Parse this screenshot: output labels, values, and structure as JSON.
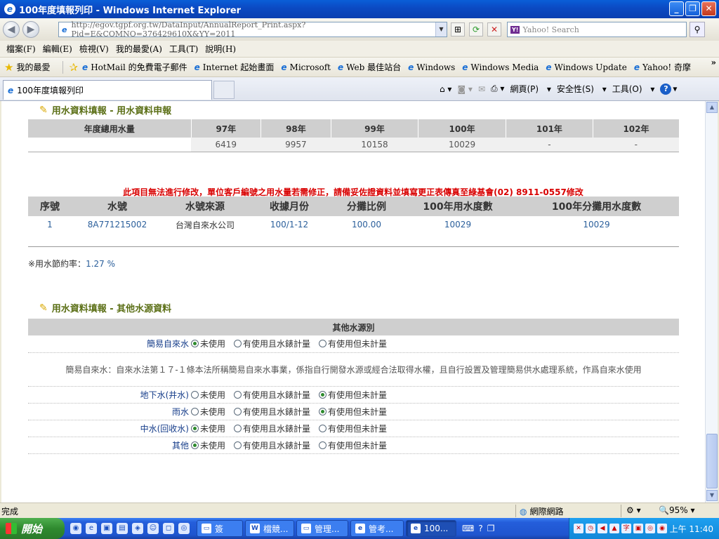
{
  "window": {
    "title": "100年度填報列印 - Windows Internet Explorer"
  },
  "addressbar": {
    "url": "http://egov.tgpf.org.tw/DataInput/AnnualReport_Print.aspx?Pid=E&COMNO=376429610X&YY=2011",
    "search_placeholder": "Yahoo! Search"
  },
  "menu": [
    "檔案(F)",
    "編輯(E)",
    "檢視(V)",
    "我的最愛(A)",
    "工具(T)",
    "說明(H)"
  ],
  "favorites": {
    "label": "我的最愛",
    "items": [
      "HotMail 的免費電子郵件",
      "Internet 起始畫面",
      "Microsoft",
      "Web 最佳站台",
      "Windows",
      "Windows Media",
      "Windows Update",
      "Yahoo! 奇摩"
    ]
  },
  "tab": {
    "label": "100年度填報列印"
  },
  "commands": {
    "page": "網頁(P)",
    "safety": "安全性(S)",
    "tools": "工具(O)"
  },
  "section1": {
    "title": "用水資料填報 - 用水資料申報",
    "row_header": "年度總用水量",
    "years": [
      "97年",
      "98年",
      "99年",
      "100年",
      "101年",
      "102年"
    ],
    "values": [
      "6419",
      "9957",
      "10158",
      "10029",
      "-",
      "-"
    ]
  },
  "notice": "此項目無法進行修改，單位客戶編號之用水量若需修正，請備妥佐證資料並填寫更正表傳真至綠基會(02) 8911-0557修改",
  "meters": {
    "headers": [
      "序號",
      "水號",
      "水號來源",
      "收據月份",
      "分攤比例",
      "100年用水度數",
      "100年分攤用水度數"
    ],
    "rows": [
      [
        "1",
        "8A771215002",
        "台灣自來水公司",
        "100/1-12",
        "100.00",
        "10029",
        "10029"
      ]
    ]
  },
  "saving": {
    "label": "※用水節約率：",
    "value": "1.27 %"
  },
  "section2": {
    "title": "用水資料填報 - 其他水源資料",
    "header": "其他水源別",
    "options": [
      "未使用",
      "有使用且水錶計量",
      "有使用但未計量"
    ],
    "rows": [
      {
        "label": "簡易自來水",
        "selected": 0
      },
      {
        "label": "地下水(井水)",
        "selected": 2
      },
      {
        "label": "雨水",
        "selected": 2
      },
      {
        "label": "中水(回收水)",
        "selected": 0
      },
      {
        "label": "其他",
        "selected": 0
      }
    ],
    "note": "簡易自來水：自來水法第１７-１條本法所稱簡易自來水事業，係指自行開發水源或經合法取得水權，且自行設置及管理簡易供水處理系統，作爲自來水使用"
  },
  "status": {
    "text": "完成",
    "zone": "網際網路",
    "zoom": "95%"
  },
  "taskbar": {
    "start": "開始",
    "tasks": [
      "簽",
      "檔競...",
      "管理...",
      "管考...",
      "100..."
    ],
    "clock": "上午 11:40"
  }
}
